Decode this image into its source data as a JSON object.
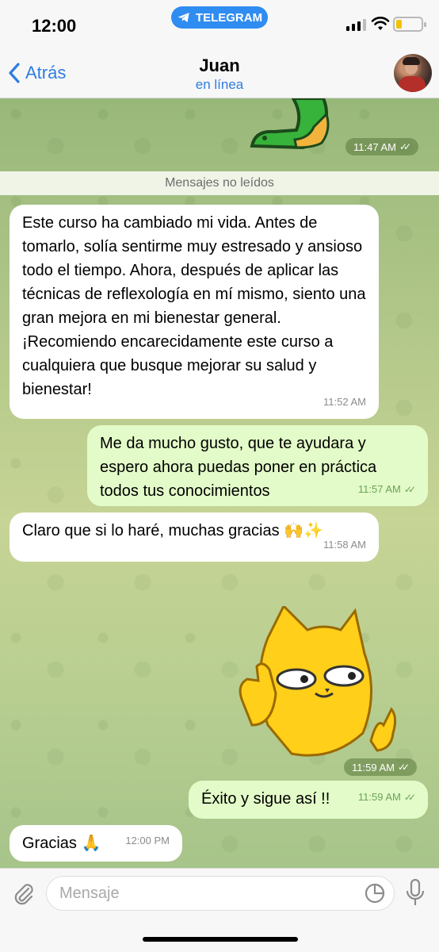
{
  "status_bar": {
    "time": "12:00",
    "app_pill": "TELEGRAM"
  },
  "header": {
    "back_label": "Atrás",
    "contact_name": "Juan",
    "contact_status": "en línea"
  },
  "chat": {
    "sticker_top_time": "11:47 AM",
    "unread_divider": "Mensajes no leídos",
    "messages": [
      {
        "direction": "in",
        "text": "Este curso ha cambiado mi vida. Antes de tomarlo, solía sentirme muy estresado y ansioso todo el tiempo. Ahora, después de aplicar las técnicas de reflexología en mí mismo, siento una gran mejora en mi bienestar general. ¡Recomiendo encarecidamente este curso a cualquiera que busque mejorar su salud y bienestar!",
        "time": "11:52 AM"
      },
      {
        "direction": "out",
        "text": "Me da mucho gusto, que te ayudara y espero ahora puedas poner en práctica todos tus conocimientos",
        "time": "11:57 AM"
      },
      {
        "direction": "in",
        "text": "Claro que si lo haré, muchas gracias 🙌✨",
        "time": "11:58 AM"
      },
      {
        "direction": "out",
        "text": "Éxito y sigue así !!",
        "time": "11:59 AM"
      },
      {
        "direction": "in",
        "text": "Gracias 🙏",
        "time": "12:00 PM"
      }
    ],
    "sticker_cat_time": "11:59 AM"
  },
  "input": {
    "placeholder": "Mensaje"
  },
  "colors": {
    "accent": "#2f7de1",
    "outgoing_bubble": "#e3fbc8",
    "incoming_bubble": "#ffffff",
    "telegram_pill": "#2f8cf0"
  },
  "icons": [
    "telegram-icon",
    "signal-icon",
    "wifi-icon",
    "battery-icon",
    "back-chevron-icon",
    "avatar",
    "attach-icon",
    "sticker-icon",
    "mic-icon",
    "double-check-icon"
  ]
}
